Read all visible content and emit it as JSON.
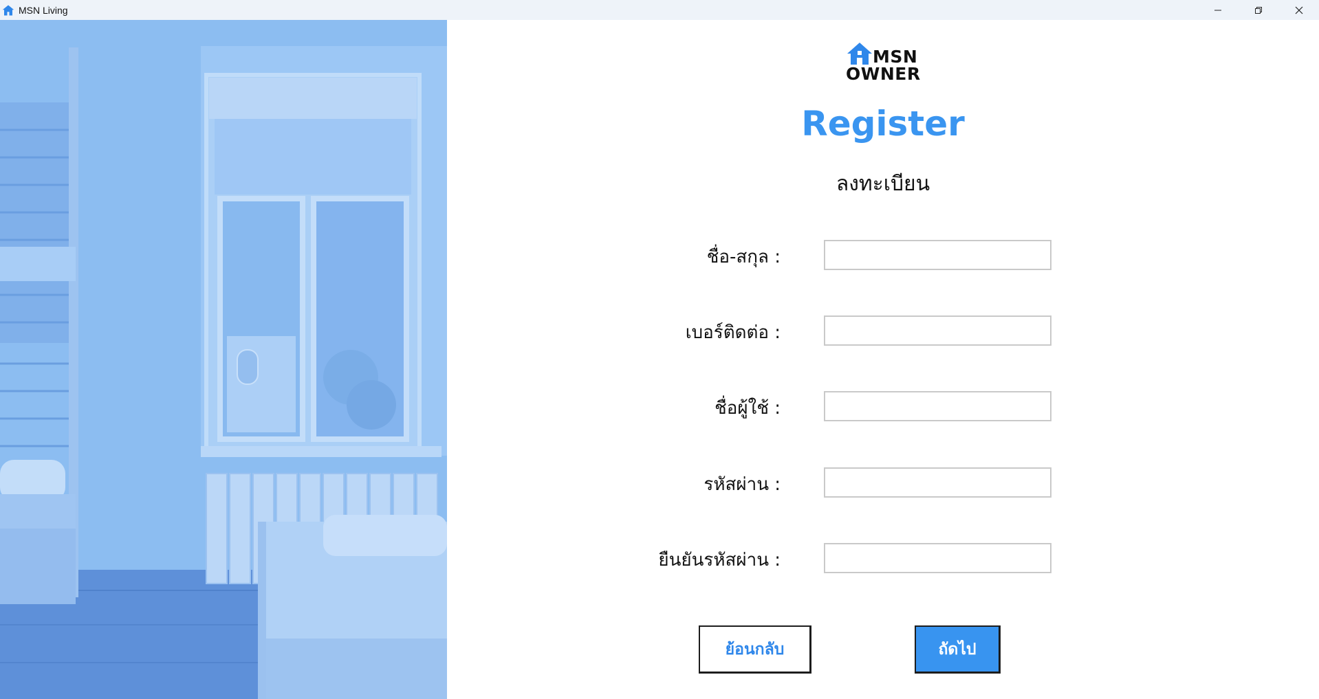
{
  "window": {
    "title": "MSN Living",
    "app_icon": "house-icon",
    "controls": [
      "minimize-icon",
      "restore-icon",
      "close-icon"
    ]
  },
  "brand": {
    "logo_top": "MSN",
    "logo_bottom": "OWNER",
    "accent_color": "#3a95f0"
  },
  "form": {
    "title": "Register",
    "subtitle": "ลงทะเบียน",
    "fields": [
      {
        "label": "ชื่อ-สกุล :",
        "value": "",
        "placeholder": ""
      },
      {
        "label": "เบอร์ติดต่อ :",
        "value": "",
        "placeholder": ""
      },
      {
        "label": "ชื่อผู้ใช้ :",
        "value": "",
        "placeholder": ""
      },
      {
        "label": "รหัสผ่าน :",
        "value": "",
        "placeholder": ""
      },
      {
        "label": "ยืนยันรหัสผ่าน :",
        "value": "",
        "placeholder": ""
      }
    ],
    "back_label": "ย้อนกลับ",
    "next_label": "ถัดไป"
  }
}
